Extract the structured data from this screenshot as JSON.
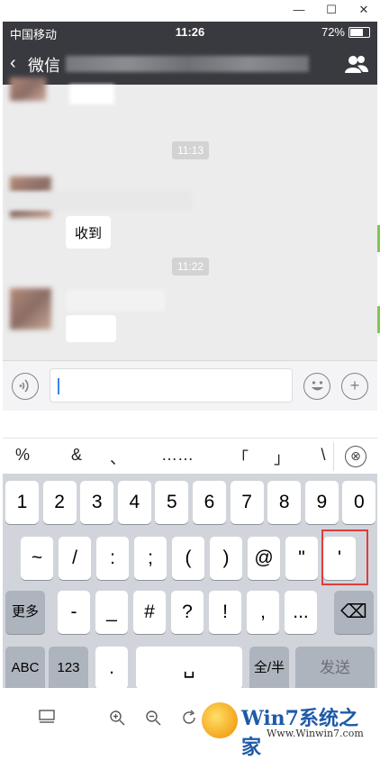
{
  "window": {
    "minimize_label": "—",
    "maximize_label": "☐",
    "close_label": "✕"
  },
  "status_bar": {
    "carrier": "中国移动",
    "time": "11:26",
    "battery": "72%",
    "battery_level": 0.72
  },
  "nav": {
    "back_label": "微信",
    "back_icon": "‹",
    "contacts_icon": "people-icon"
  },
  "chat": {
    "time_chips": [
      "11:13",
      "11:22"
    ],
    "messages": [
      {
        "text": "收到"
      }
    ]
  },
  "input_bar": {
    "voice_icon": "voice-icon",
    "emoji_icon": "emoji-icon",
    "plus_label": "+"
  },
  "keyboard": {
    "symbol_row": [
      "%",
      "&",
      "、",
      "……",
      "「",
      "」",
      "\\"
    ],
    "delete_symbol_label": "⊗",
    "row1": [
      "1",
      "2",
      "3",
      "4",
      "5",
      "6",
      "7",
      "8",
      "9",
      "0"
    ],
    "row2": [
      "~",
      "/",
      ":",
      ";",
      "(",
      ")",
      "@",
      "\"",
      "'"
    ],
    "row3_left": "更多",
    "row3": [
      "-",
      "_",
      "#",
      "?",
      "!",
      ",",
      "..."
    ],
    "row3_delete": "⌫",
    "abc": "ABC",
    "num": "123",
    "dot": ".",
    "space": "␣",
    "fullwidth": "全/半",
    "send": "发送"
  },
  "toolbar": {
    "icons": [
      "panel-icon",
      "zoom-in-icon",
      "zoom-out-icon",
      "rotate-icon"
    ]
  },
  "watermark": {
    "brand": "Win7系统之家",
    "url": "Www.Winwin7.com"
  }
}
